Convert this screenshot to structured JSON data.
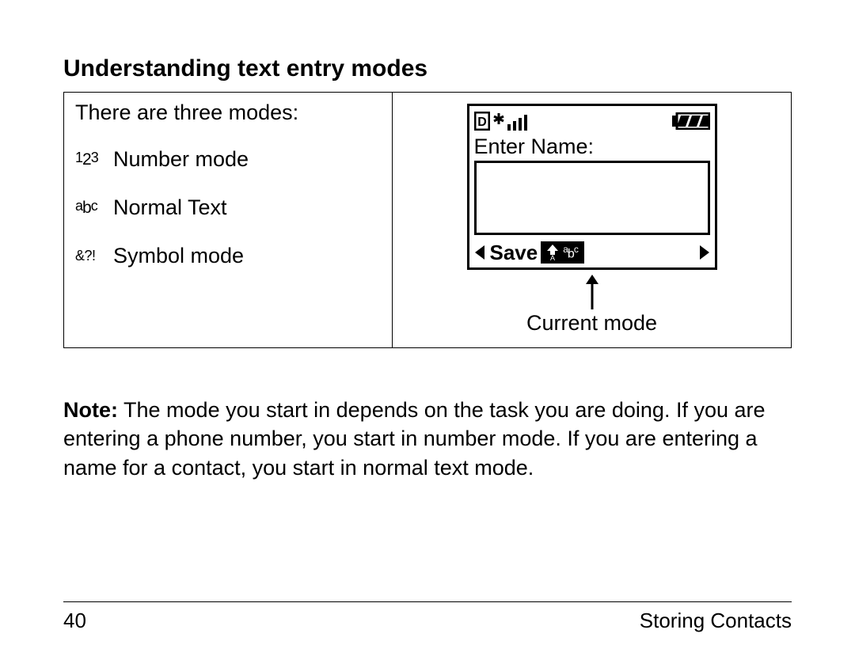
{
  "heading": "Understanding text entry modes",
  "left": {
    "intro": "There are three modes:",
    "modes": [
      {
        "icon_html": "number",
        "label": "Number mode"
      },
      {
        "icon_html": "abc",
        "label": "Normal Text"
      },
      {
        "icon_html": "symbol",
        "label": "Symbol mode"
      }
    ]
  },
  "phone": {
    "prompt": "Enter Name:",
    "save_label": "Save",
    "mode_indicator": "abc"
  },
  "callout": "Current mode",
  "note": {
    "prefix": "Note:",
    "body": " The mode you start in depends on the task you are doing. If you are entering a phone number, you start in number mode. If you are entering a name for a contact, you start in normal text mode."
  },
  "footer": {
    "page": "40",
    "section": "Storing Contacts"
  }
}
